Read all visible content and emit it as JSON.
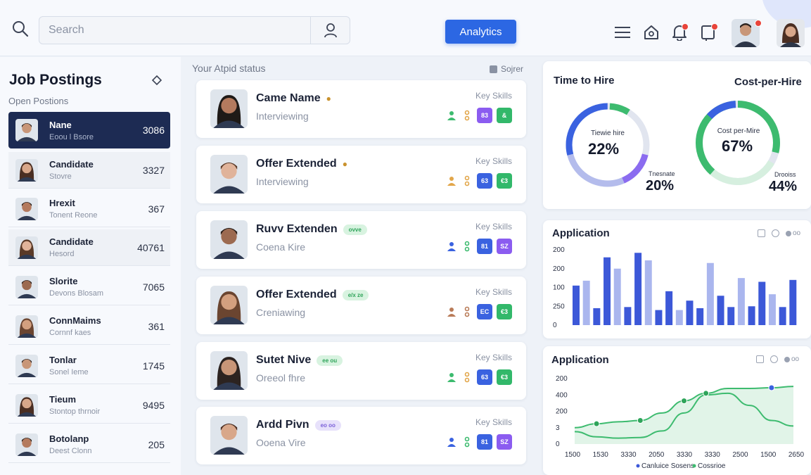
{
  "topbar": {
    "search_placeholder": "Search",
    "analytics_label": "Analytics",
    "icons": [
      "search-icon",
      "user-icon",
      "menu-icon",
      "home-icon",
      "bell-icon",
      "tablet-icon"
    ],
    "accent": "#2c67e3"
  },
  "sidebar": {
    "title": "Job Postings",
    "subtitle": "Open Postions",
    "items": [
      {
        "name": "Nane",
        "sub": "Eoou l Bsore",
        "count": "3086",
        "active": true
      },
      {
        "name": "Candidate",
        "sub": "Stovre",
        "count": "3327"
      },
      {
        "name": "Hrexit",
        "sub": "Tonent Reone",
        "count": "367"
      },
      {
        "name": "Candidate",
        "sub": "Hesord",
        "count": "40761"
      },
      {
        "name": "Slorite",
        "sub": "Devons Blosam",
        "count": "7065"
      },
      {
        "name": "ConnMaims",
        "sub": "Cornnf kaes",
        "count": "361"
      },
      {
        "name": "Tonlar",
        "sub": "Sonel Ieme",
        "count": "1745"
      },
      {
        "name": "Tieum",
        "sub": "Stontop thrnoir",
        "count": "9495"
      },
      {
        "name": "Botolanp",
        "sub": "Deest Clonn",
        "count": "205"
      }
    ]
  },
  "pipeline": {
    "label": "Your Atpid status",
    "sort_label": "Sojrer",
    "key_skills_label": "Key Skills",
    "candidates": [
      {
        "name": "Came Name",
        "status": "Interviewing",
        "pill": "",
        "skills": [
          "83",
          "&"
        ],
        "skill_colors": [
          "purple",
          "green"
        ]
      },
      {
        "name": "Offer Extended",
        "status": "Interviewing",
        "pill": "",
        "skills": [
          "63",
          "€3"
        ],
        "skill_colors": [
          "blue",
          "green"
        ]
      },
      {
        "name": "Ruvv Extenden",
        "status": "Coena Kire",
        "pill": "ovve",
        "skills": [
          "81",
          "SZ"
        ],
        "skill_colors": [
          "blue",
          "purple"
        ]
      },
      {
        "name": "Offer Extended",
        "status": "Creniawing",
        "pill": "e/x ze",
        "skills": [
          "EC",
          "€3"
        ],
        "skill_colors": [
          "blue",
          "green"
        ]
      },
      {
        "name": "Sutet Nive",
        "status": "Oreeol fhre",
        "pill": "ee ou",
        "skills": [
          "63",
          "€3"
        ],
        "skill_colors": [
          "blue",
          "green"
        ]
      },
      {
        "name": "Ardd Pivn",
        "status": "Ooena Vire",
        "pill": "eo oo",
        "pill_color": "purple",
        "skills": [
          "81",
          "SZ"
        ],
        "skill_colors": [
          "blue",
          "purple"
        ]
      }
    ]
  },
  "metrics": {
    "time_to_hire_title": "Time to Hire",
    "cost_per_hire_title": "Cost-per-Hire",
    "ring1": {
      "label": "Tiewie hire",
      "value": "22%",
      "side_label": "Tnesnate",
      "side_value": "20%"
    },
    "ring2": {
      "label": "Cost per-Mire",
      "value": "67%",
      "side_label": "Drooiss",
      "side_value": "44%"
    },
    "colors": {
      "blue": "#3a62e0",
      "green": "#3dbb6f",
      "purple": "#8b6cf0",
      "light": "#e1e5ef"
    }
  },
  "chart_data": [
    {
      "type": "bar",
      "title": "Application",
      "y_ticks": [
        "200",
        "200",
        "100",
        "250",
        "0"
      ],
      "values": [
        105,
        118,
        45,
        180,
        150,
        48,
        192,
        172,
        40,
        90,
        40,
        65,
        45,
        165,
        78,
        48,
        125,
        50,
        115,
        82,
        48,
        120
      ],
      "series_colors": [
        "#3c58d8",
        "#aab6ee"
      ]
    },
    {
      "type": "line",
      "title": "Application",
      "y_ticks": [
        "200",
        "400",
        "200",
        "3",
        "0"
      ],
      "x_ticks": [
        "1500",
        "1530",
        "3330",
        "2050",
        "3330",
        "3330",
        "2500",
        "1500",
        "2650"
      ],
      "series": [
        {
          "name": "Canluice Sosens",
          "color": "#3c58d8",
          "values": [
            50,
            62,
            68,
            72,
            95,
            132,
            155,
            170,
            170,
            172,
            176
          ]
        },
        {
          "name": "Cossrioe",
          "color": "#3dbb6f",
          "values": [
            38,
            22,
            18,
            20,
            40,
            95,
            150,
            155,
            118,
            72,
            55
          ]
        }
      ]
    }
  ]
}
